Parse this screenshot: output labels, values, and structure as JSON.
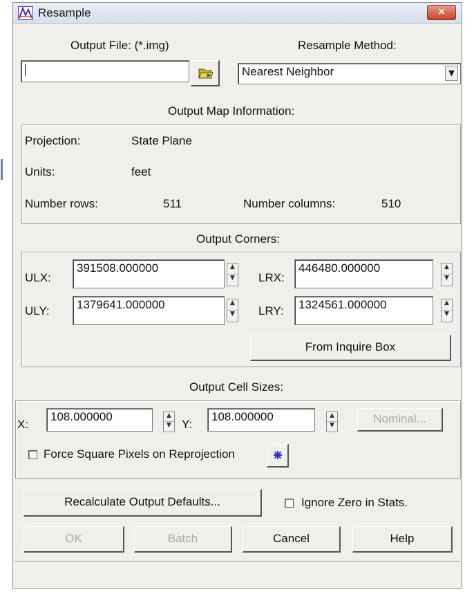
{
  "window": {
    "title": "Resample",
    "close_symbol": "×"
  },
  "output_file": {
    "label": "Output File: (*.img)",
    "value": "",
    "folder_icon": "folder-open-icon"
  },
  "resample_method": {
    "label": "Resample Method:",
    "selected": "Nearest Neighbor",
    "arrow": "▼"
  },
  "output_map_info": {
    "title": "Output Map Information:",
    "projection_label": "Projection:",
    "projection_value": "State Plane",
    "units_label": "Units:",
    "units_value": "feet",
    "rows_label": "Number rows:",
    "rows_value": "511",
    "cols_label": "Number columns:",
    "cols_value": "510"
  },
  "output_corners": {
    "title": "Output Corners:",
    "ulx_label": "ULX:",
    "ulx_value": "391508.000000",
    "uly_label": "ULY:",
    "uly_value": "1379641.000000",
    "lrx_label": "LRX:",
    "lrx_value": "446480.000000",
    "lry_label": "LRY:",
    "lry_value": "1324561.000000",
    "inquire_button": "From Inquire Box"
  },
  "output_cell_sizes": {
    "title": "Output Cell Sizes:",
    "x_label": "X:",
    "x_value": "108.000000",
    "y_label": "Y:",
    "y_value": "108.000000",
    "nominal_button": "Nominal...",
    "force_square_label": "Force Square Pixels on Reprojection",
    "force_square_checked": false,
    "star_icon": "asterisk-icon"
  },
  "actions": {
    "recalculate": "Recalculate Output Defaults...",
    "ignore_zero_label": "Ignore Zero in Stats.",
    "ignore_zero_checked": false,
    "ok": "OK",
    "batch": "Batch",
    "cancel": "Cancel",
    "help": "Help"
  },
  "spinner": {
    "up": "▲",
    "down": "▼"
  },
  "colors": {
    "dialog_bg": "#efefec",
    "close_button": "#c8432b",
    "disabled_text": "#a9a9a9"
  }
}
